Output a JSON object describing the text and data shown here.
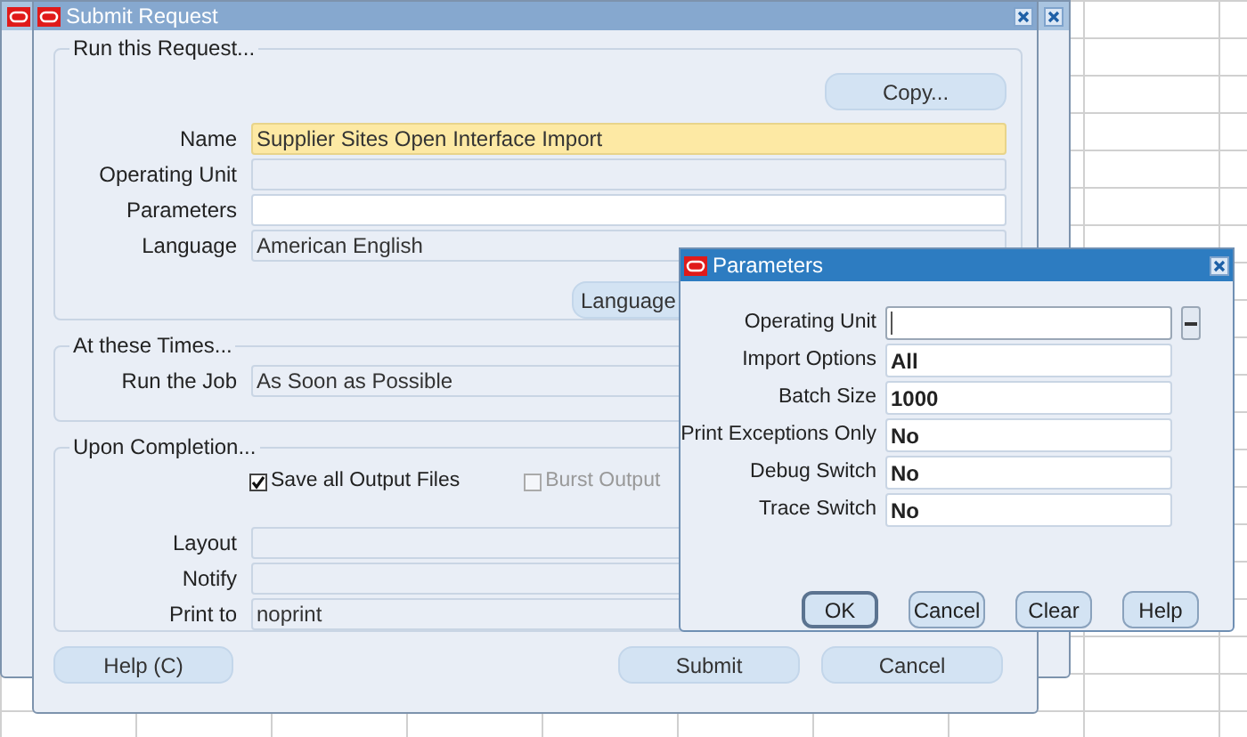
{
  "submit_request": {
    "title": "Submit Request",
    "run_group": {
      "title": "Run this Request...",
      "copy_button": "Copy...",
      "language_button": "Language",
      "fields": [
        {
          "label": "Name",
          "value": "Supplier Sites Open Interface Import",
          "kind": "required"
        },
        {
          "label": "Operating Unit",
          "kind": "readonly"
        },
        {
          "label": "Parameters",
          "kind": "editable"
        },
        {
          "label": "Language",
          "value": "American English",
          "kind": "readonly"
        }
      ]
    },
    "times_group": {
      "title": "At these Times...",
      "fields": [
        {
          "label": "Run the Job",
          "value": "As Soon as Possible",
          "kind": "readonly"
        }
      ]
    },
    "completion_group": {
      "title": "Upon Completion...",
      "checkboxes": [
        {
          "label": "Save all Output Files",
          "checked": true,
          "disabled": false
        },
        {
          "label": "Burst Output",
          "checked": false,
          "disabled": true
        }
      ],
      "fields": [
        {
          "label": "Layout",
          "kind": "readonly"
        },
        {
          "label": "Notify",
          "kind": "readonly"
        },
        {
          "label": "Print to",
          "value": "noprint",
          "kind": "readonly"
        }
      ]
    },
    "help_button": "Help (C)",
    "buttons": [
      "Submit",
      "Cancel"
    ]
  },
  "parameters_dialog": {
    "title": "Parameters",
    "fields": [
      {
        "label": "Operating Unit",
        "focused": true,
        "lov": true
      },
      {
        "label": "Import Options",
        "value": "All",
        "focused": false,
        "lov": false
      },
      {
        "label": "Batch Size",
        "value": "1000",
        "focused": false,
        "lov": false
      },
      {
        "label": "Print Exceptions Only",
        "value": "No",
        "focused": false,
        "lov": false
      },
      {
        "label": "Debug Switch",
        "value": "No",
        "focused": false,
        "lov": false
      },
      {
        "label": "Trace Switch",
        "value": "No",
        "focused": false,
        "lov": false
      }
    ],
    "buttons": [
      {
        "label": "OK",
        "default": true
      },
      {
        "label": "Cancel",
        "default": false
      },
      {
        "label": "Clear",
        "default": false
      },
      {
        "label": "Help",
        "default": false
      }
    ]
  }
}
